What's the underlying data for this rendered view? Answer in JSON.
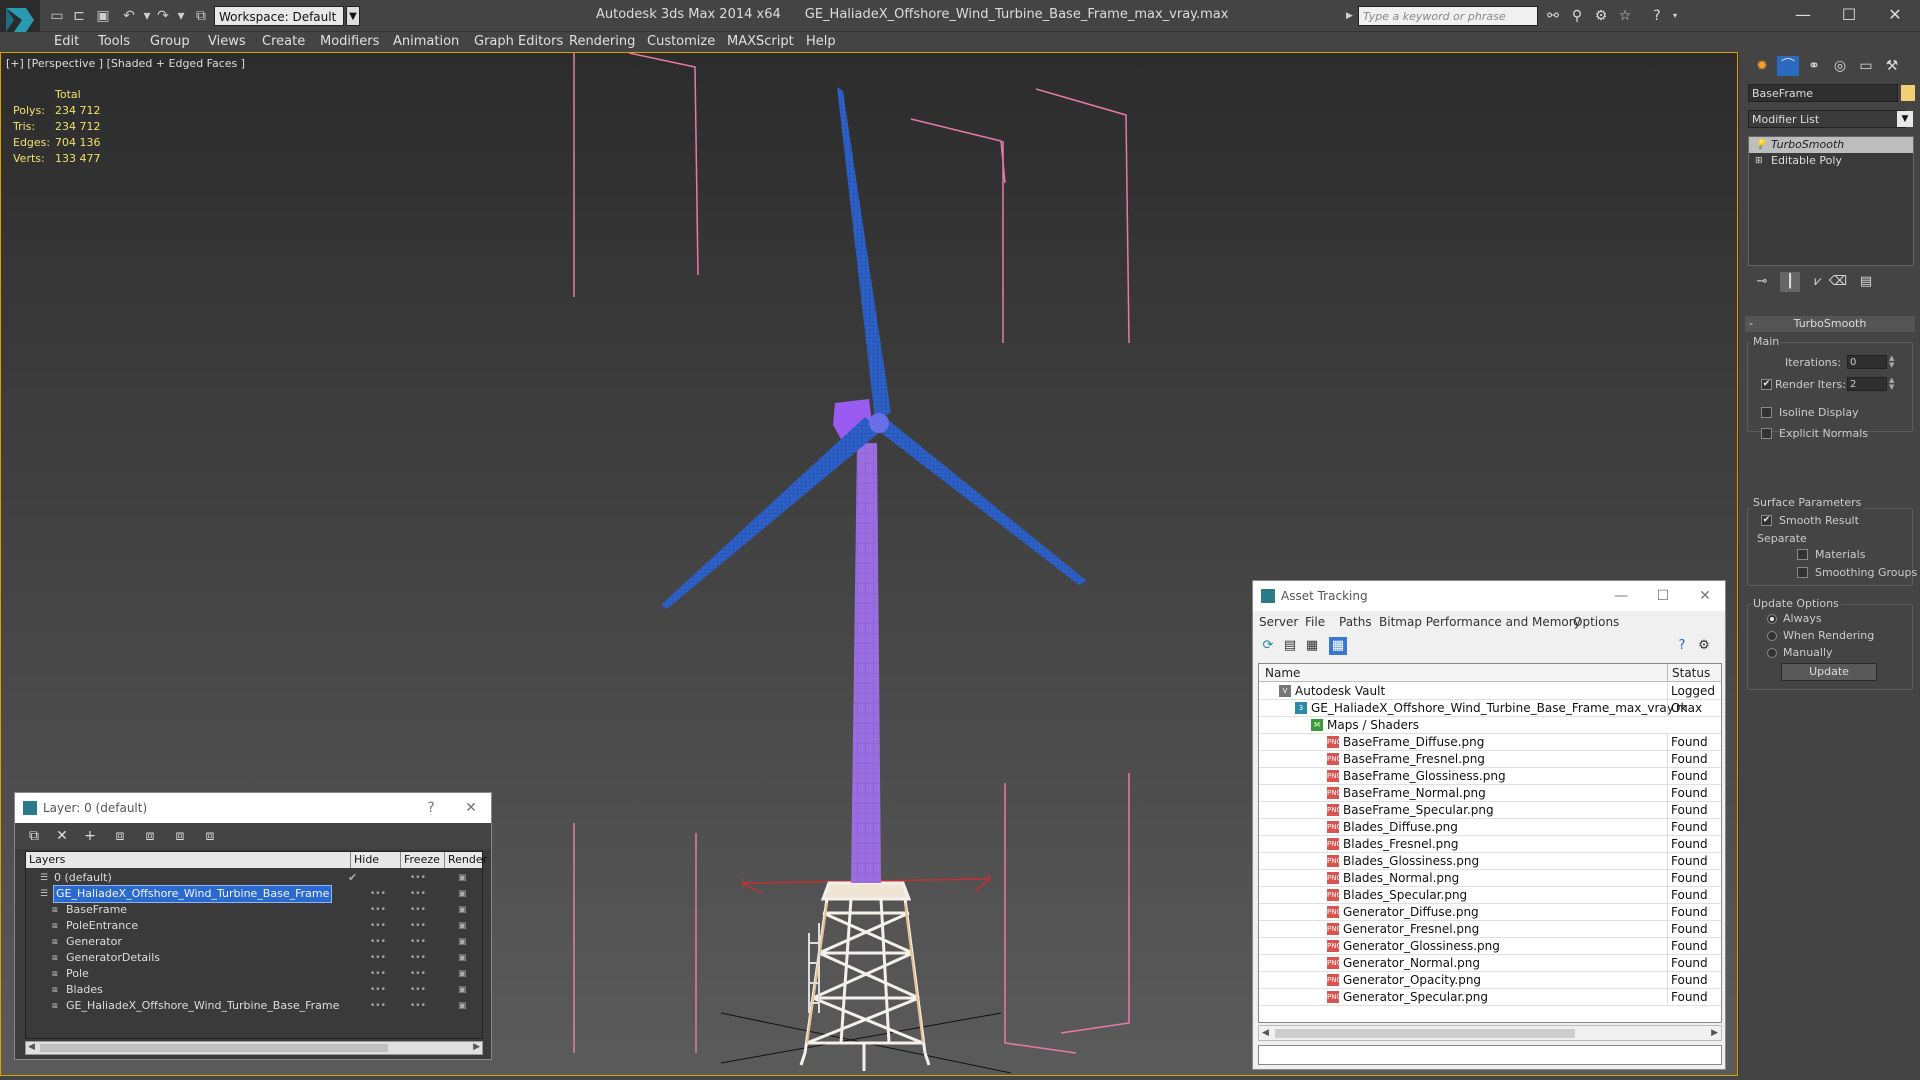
{
  "app": {
    "product": "Autodesk 3ds Max  2014 x64",
    "file": "GE_HaliadeX_Offshore_Wind_Turbine_Base_Frame_max_vray.max",
    "workspace": "Workspace: Default",
    "search_placeholder": "Type a keyword or phrase"
  },
  "menu": [
    "Edit",
    "Tools",
    "Group",
    "Views",
    "Create",
    "Modifiers",
    "Animation",
    "Graph Editors",
    "Rendering",
    "Customize",
    "MAXScript",
    "Help"
  ],
  "viewport": {
    "label": "[+] [Perspective ] [Shaded + Edged Faces ]",
    "stats": {
      "header": "Total",
      "rows": [
        {
          "k": "Polys:",
          "v": "234 712"
        },
        {
          "k": "Tris:",
          "v": "234 712"
        },
        {
          "k": "Edges:",
          "v": "704 136"
        },
        {
          "k": "Verts:",
          "v": "133 477"
        }
      ]
    }
  },
  "command_panel": {
    "object_name": "BaseFrame",
    "modifier_list": "Modifier List",
    "stack": [
      "TurboSmooth",
      "Editable Poly"
    ],
    "rollout": "TurboSmooth",
    "main": {
      "title": "Main",
      "iterations_label": "Iterations:",
      "iterations": "0",
      "render_iters_label": "Render Iters:",
      "render_iters": "2",
      "isoline": "Isoline Display",
      "explicit": "Explicit Normals"
    },
    "surface": {
      "title": "Surface Parameters",
      "smooth": "Smooth Result",
      "separate": "Separate",
      "materials": "Materials",
      "smoothing_groups": "Smoothing Groups"
    },
    "update": {
      "title": "Update Options",
      "always": "Always",
      "when_rendering": "When Rendering",
      "manually": "Manually",
      "button": "Update"
    }
  },
  "layer_window": {
    "title": "Layer: 0 (default)",
    "help": "?",
    "columns": [
      "Layers",
      "Hide",
      "Freeze",
      "Render"
    ],
    "rows": [
      {
        "name": "0 (default)",
        "indent": 0
      },
      {
        "name": "GE_HaliadeX_Offshore_Wind_Turbine_Base_Frame",
        "indent": 0,
        "selected": true
      },
      {
        "name": "BaseFrame",
        "indent": 1
      },
      {
        "name": "PoleEntrance",
        "indent": 1
      },
      {
        "name": "Generator",
        "indent": 1
      },
      {
        "name": "GeneratorDetails",
        "indent": 1
      },
      {
        "name": "Pole",
        "indent": 1
      },
      {
        "name": "Blades",
        "indent": 1
      },
      {
        "name": "GE_HaliadeX_Offshore_Wind_Turbine_Base_Frame",
        "indent": 1
      }
    ]
  },
  "asset_window": {
    "title": "Asset Tracking",
    "menu": [
      "Server",
      "File",
      "Paths",
      "Bitmap Performance and Memory",
      "Options"
    ],
    "columns": [
      "Name",
      "Status"
    ],
    "rows": [
      {
        "name": "Autodesk Vault",
        "status": "Logged Out",
        "level": 0,
        "icon": "vault"
      },
      {
        "name": "GE_HaliadeX_Offshore_Wind_Turbine_Base_Frame_max_vray.max",
        "status": "Ok",
        "level": 1,
        "icon": "maxf"
      },
      {
        "name": "Maps / Shaders",
        "status": "",
        "level": 2,
        "icon": "maps"
      },
      {
        "name": "BaseFrame_Diffuse.png",
        "status": "Found",
        "level": 3,
        "icon": "png"
      },
      {
        "name": "BaseFrame_Fresnel.png",
        "status": "Found",
        "level": 3,
        "icon": "png"
      },
      {
        "name": "BaseFrame_Glossiness.png",
        "status": "Found",
        "level": 3,
        "icon": "png"
      },
      {
        "name": "BaseFrame_Normal.png",
        "status": "Found",
        "level": 3,
        "icon": "png"
      },
      {
        "name": "BaseFrame_Specular.png",
        "status": "Found",
        "level": 3,
        "icon": "png"
      },
      {
        "name": "Blades_Diffuse.png",
        "status": "Found",
        "level": 3,
        "icon": "png"
      },
      {
        "name": "Blades_Fresnel.png",
        "status": "Found",
        "level": 3,
        "icon": "png"
      },
      {
        "name": "Blades_Glossiness.png",
        "status": "Found",
        "level": 3,
        "icon": "png"
      },
      {
        "name": "Blades_Normal.png",
        "status": "Found",
        "level": 3,
        "icon": "png"
      },
      {
        "name": "Blades_Specular.png",
        "status": "Found",
        "level": 3,
        "icon": "png"
      },
      {
        "name": "Generator_Diffuse.png",
        "status": "Found",
        "level": 3,
        "icon": "png"
      },
      {
        "name": "Generator_Fresnel.png",
        "status": "Found",
        "level": 3,
        "icon": "png"
      },
      {
        "name": "Generator_Glossiness.png",
        "status": "Found",
        "level": 3,
        "icon": "png"
      },
      {
        "name": "Generator_Normal.png",
        "status": "Found",
        "level": 3,
        "icon": "png"
      },
      {
        "name": "Generator_Opacity.png",
        "status": "Found",
        "level": 3,
        "icon": "png"
      },
      {
        "name": "Generator_Specular.png",
        "status": "Found",
        "level": 3,
        "icon": "png"
      }
    ]
  },
  "colors": {
    "tower": "#9a6ee0",
    "blades": "#2f62c8",
    "frame": "#f4f0ea",
    "bbox": "#e87aa8",
    "viewport_border": "#d8a000"
  }
}
